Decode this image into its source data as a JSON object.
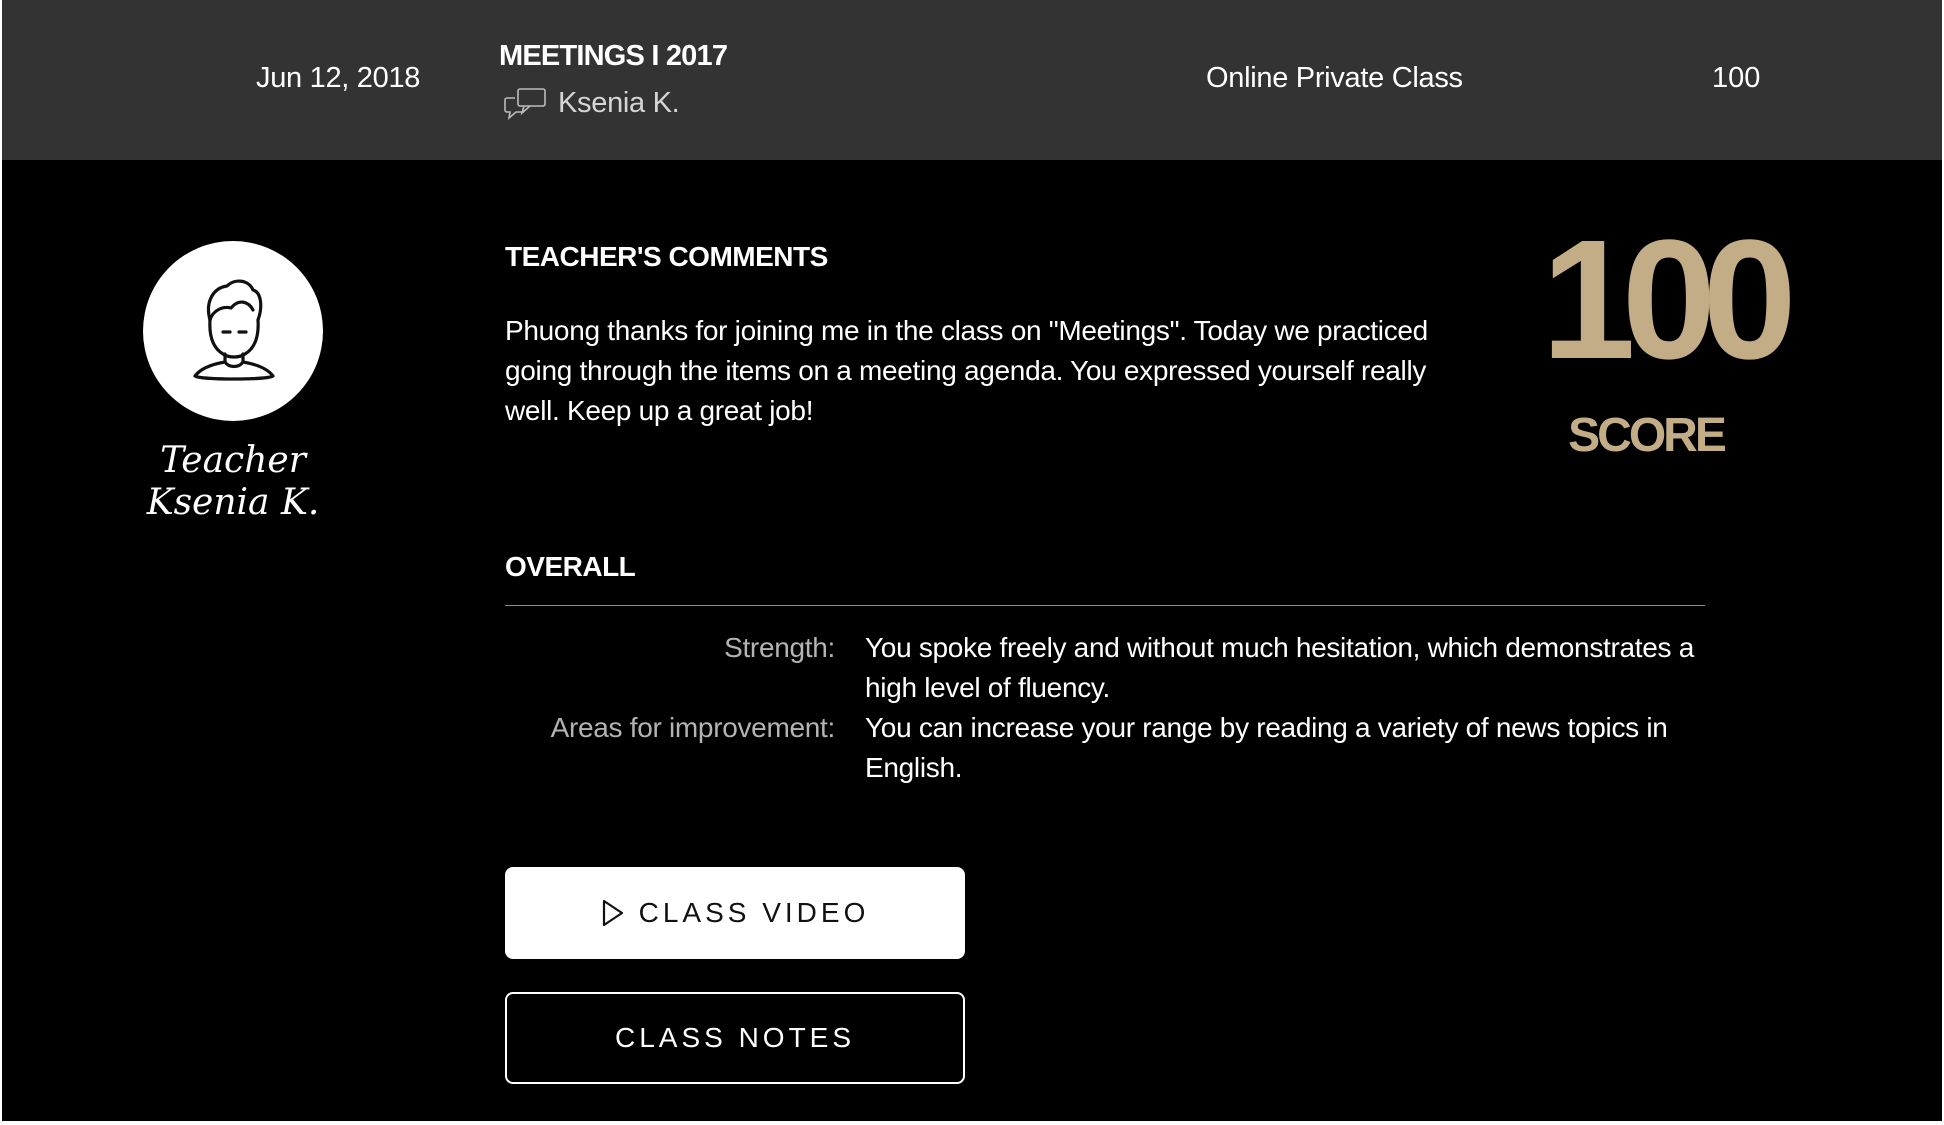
{
  "colors": {
    "header_bg": "#333333",
    "page_bg": "#000000",
    "accent_gold": "#c3ad87",
    "label_gray": "#b3b3b3"
  },
  "header": {
    "date": "Jun 12, 2018",
    "title": "MEETINGS I 2017",
    "teacher_icon": "chat-bubbles-icon",
    "teacher_name": "Ksenia K.",
    "class_type": "Online Private Class",
    "score": "100"
  },
  "teacher": {
    "avatar_icon": "person-avatar-icon",
    "role": "Teacher",
    "name": "Ksenia K."
  },
  "comments": {
    "title": "TEACHER'S COMMENTS",
    "body": "Phuong thanks for joining me in the class on \"Meetings\". Today we practiced going through the items on a meeting agenda. You expressed yourself really well. Keep up a great job!"
  },
  "score": {
    "value": "100",
    "label": "SCORE"
  },
  "overall": {
    "title": "OVERALL",
    "strength_label": "Strength:",
    "strength_text": "You spoke freely and without much hesitation, which demonstrates a high level of fluency.",
    "improvement_label": "Areas for improvement:",
    "improvement_text": "You can increase your range by reading a variety of news topics in English."
  },
  "buttons": {
    "video_icon": "play-icon",
    "video_label": "CLASS VIDEO",
    "notes_label": "CLASS NOTES"
  }
}
